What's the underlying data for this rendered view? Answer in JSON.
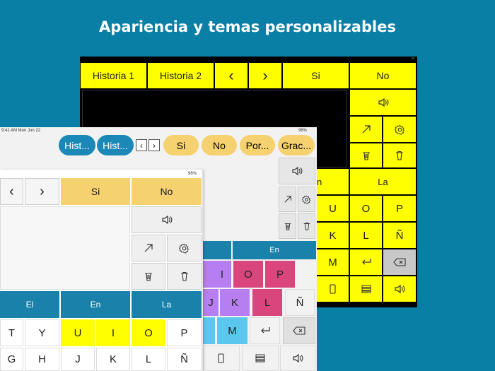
{
  "headline": "Apariencia y temas personalizables",
  "dev1": {
    "top_row": [
      "Historia 1",
      "Historia 2",
      "‹",
      "›",
      "Si",
      "No"
    ],
    "right_word": "La",
    "left_cut_word": "n",
    "letters_rows": [
      [
        "U",
        "I",
        "O",
        "P"
      ],
      [
        "J",
        "K",
        "L",
        "Ñ"
      ],
      [
        "N",
        "M"
      ]
    ]
  },
  "dev2": {
    "status_time": "9:41 AM  Mon Jun 22",
    "status_battery": "96%",
    "pills": [
      "Hist...",
      "Hist...",
      "Si",
      "No",
      "Por...",
      "Grac..."
    ],
    "word_en": "En",
    "letters_row1": [
      "I",
      "O",
      "P"
    ],
    "letters_row2": [
      "J",
      "K",
      "L",
      "Ñ"
    ],
    "letters_row3": [
      "M"
    ]
  },
  "dev3": {
    "status_battery": "96%",
    "nav": [
      "‹",
      "›"
    ],
    "si": "Si",
    "no": "No",
    "words": [
      "El",
      "En",
      "La"
    ],
    "row1": [
      "T",
      "Y",
      "U",
      "I",
      "O",
      "P"
    ],
    "row2": [
      "G",
      "H",
      "J",
      "K",
      "L",
      "Ñ"
    ]
  },
  "colors": {
    "background": "#0a7fa6",
    "yellow": "#ffff00",
    "blue": "#1a82aa",
    "pill_blue": "#1b88b8",
    "pill_yellow": "#f5d170",
    "purple": "#b67ef0",
    "pink": "#d9457c",
    "light_blue": "#5bc7ee"
  }
}
